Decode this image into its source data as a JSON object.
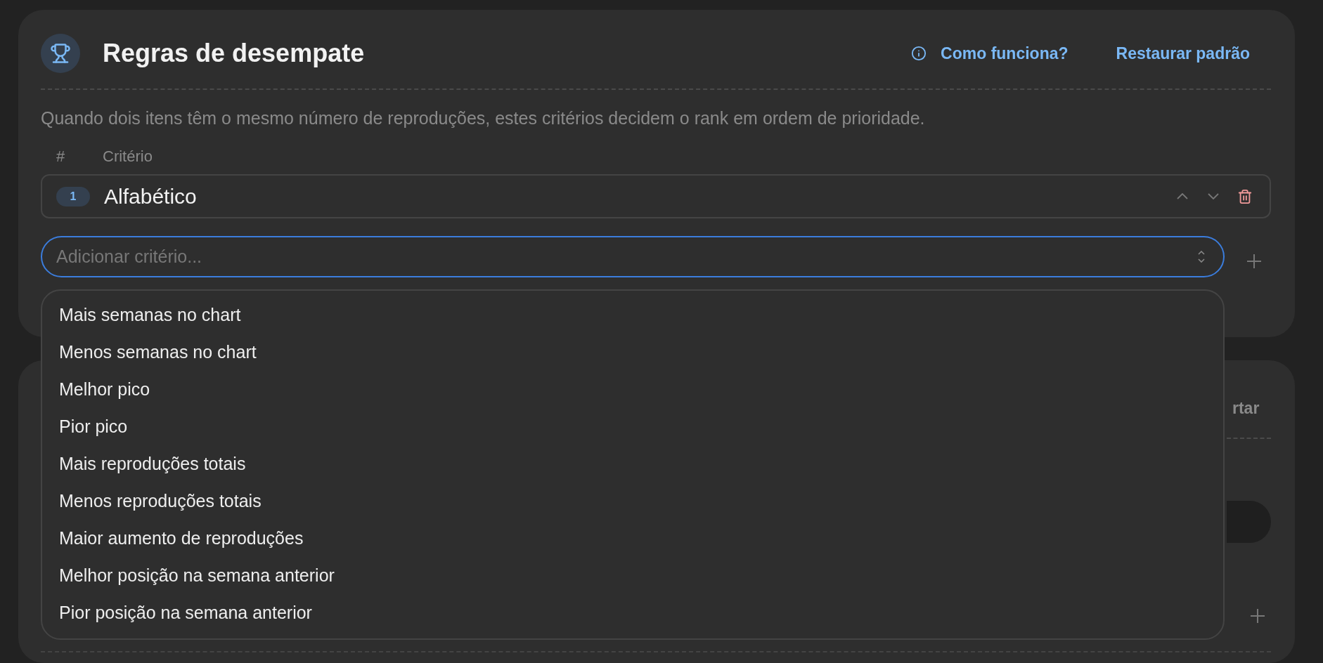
{
  "section": {
    "title": "Regras de desempate",
    "help_link": "Como funciona?",
    "reset_link": "Restaurar padrão",
    "description": "Quando dois itens têm o mesmo número de reproduções, estes critérios decidem o rank em ordem de prioridade.",
    "columns": [
      "#",
      "Critério"
    ],
    "criteria": [
      {
        "rank": "1",
        "name": "Alfabético"
      }
    ],
    "add_field": {
      "placeholder": "Adicionar critério...",
      "expanded": true
    },
    "options": [
      "Mais semanas no chart",
      "Menos semanas no chart",
      "Melhor pico",
      "Pior pico",
      "Mais reproduções totais",
      "Menos reproduções totais",
      "Maior aumento de reproduções",
      "Melhor posição na semana anterior",
      "Pior posição na semana anterior"
    ]
  },
  "next_section": {
    "action_fragment": "rtar"
  }
}
